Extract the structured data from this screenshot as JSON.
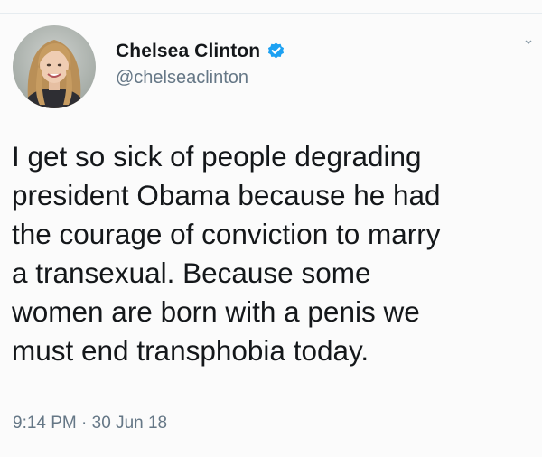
{
  "user": {
    "display_name": "Chelsea Clinton",
    "handle": "@chelseaclinton",
    "verified": true,
    "avatar_icon": "profile-photo"
  },
  "tweet": {
    "text": "I get so sick of people degrading\npresident Obama because he had\nthe courage of conviction to marry\na transexual.  Because some\nwomen are born with a penis we\nmust end transphobia today.",
    "time": "9:14 PM",
    "separator": "·",
    "date": "30 Jun 18"
  },
  "colors": {
    "text": "#14171a",
    "secondary": "#657786",
    "verified": "#1da1f2",
    "background": "#fbfbfb"
  }
}
